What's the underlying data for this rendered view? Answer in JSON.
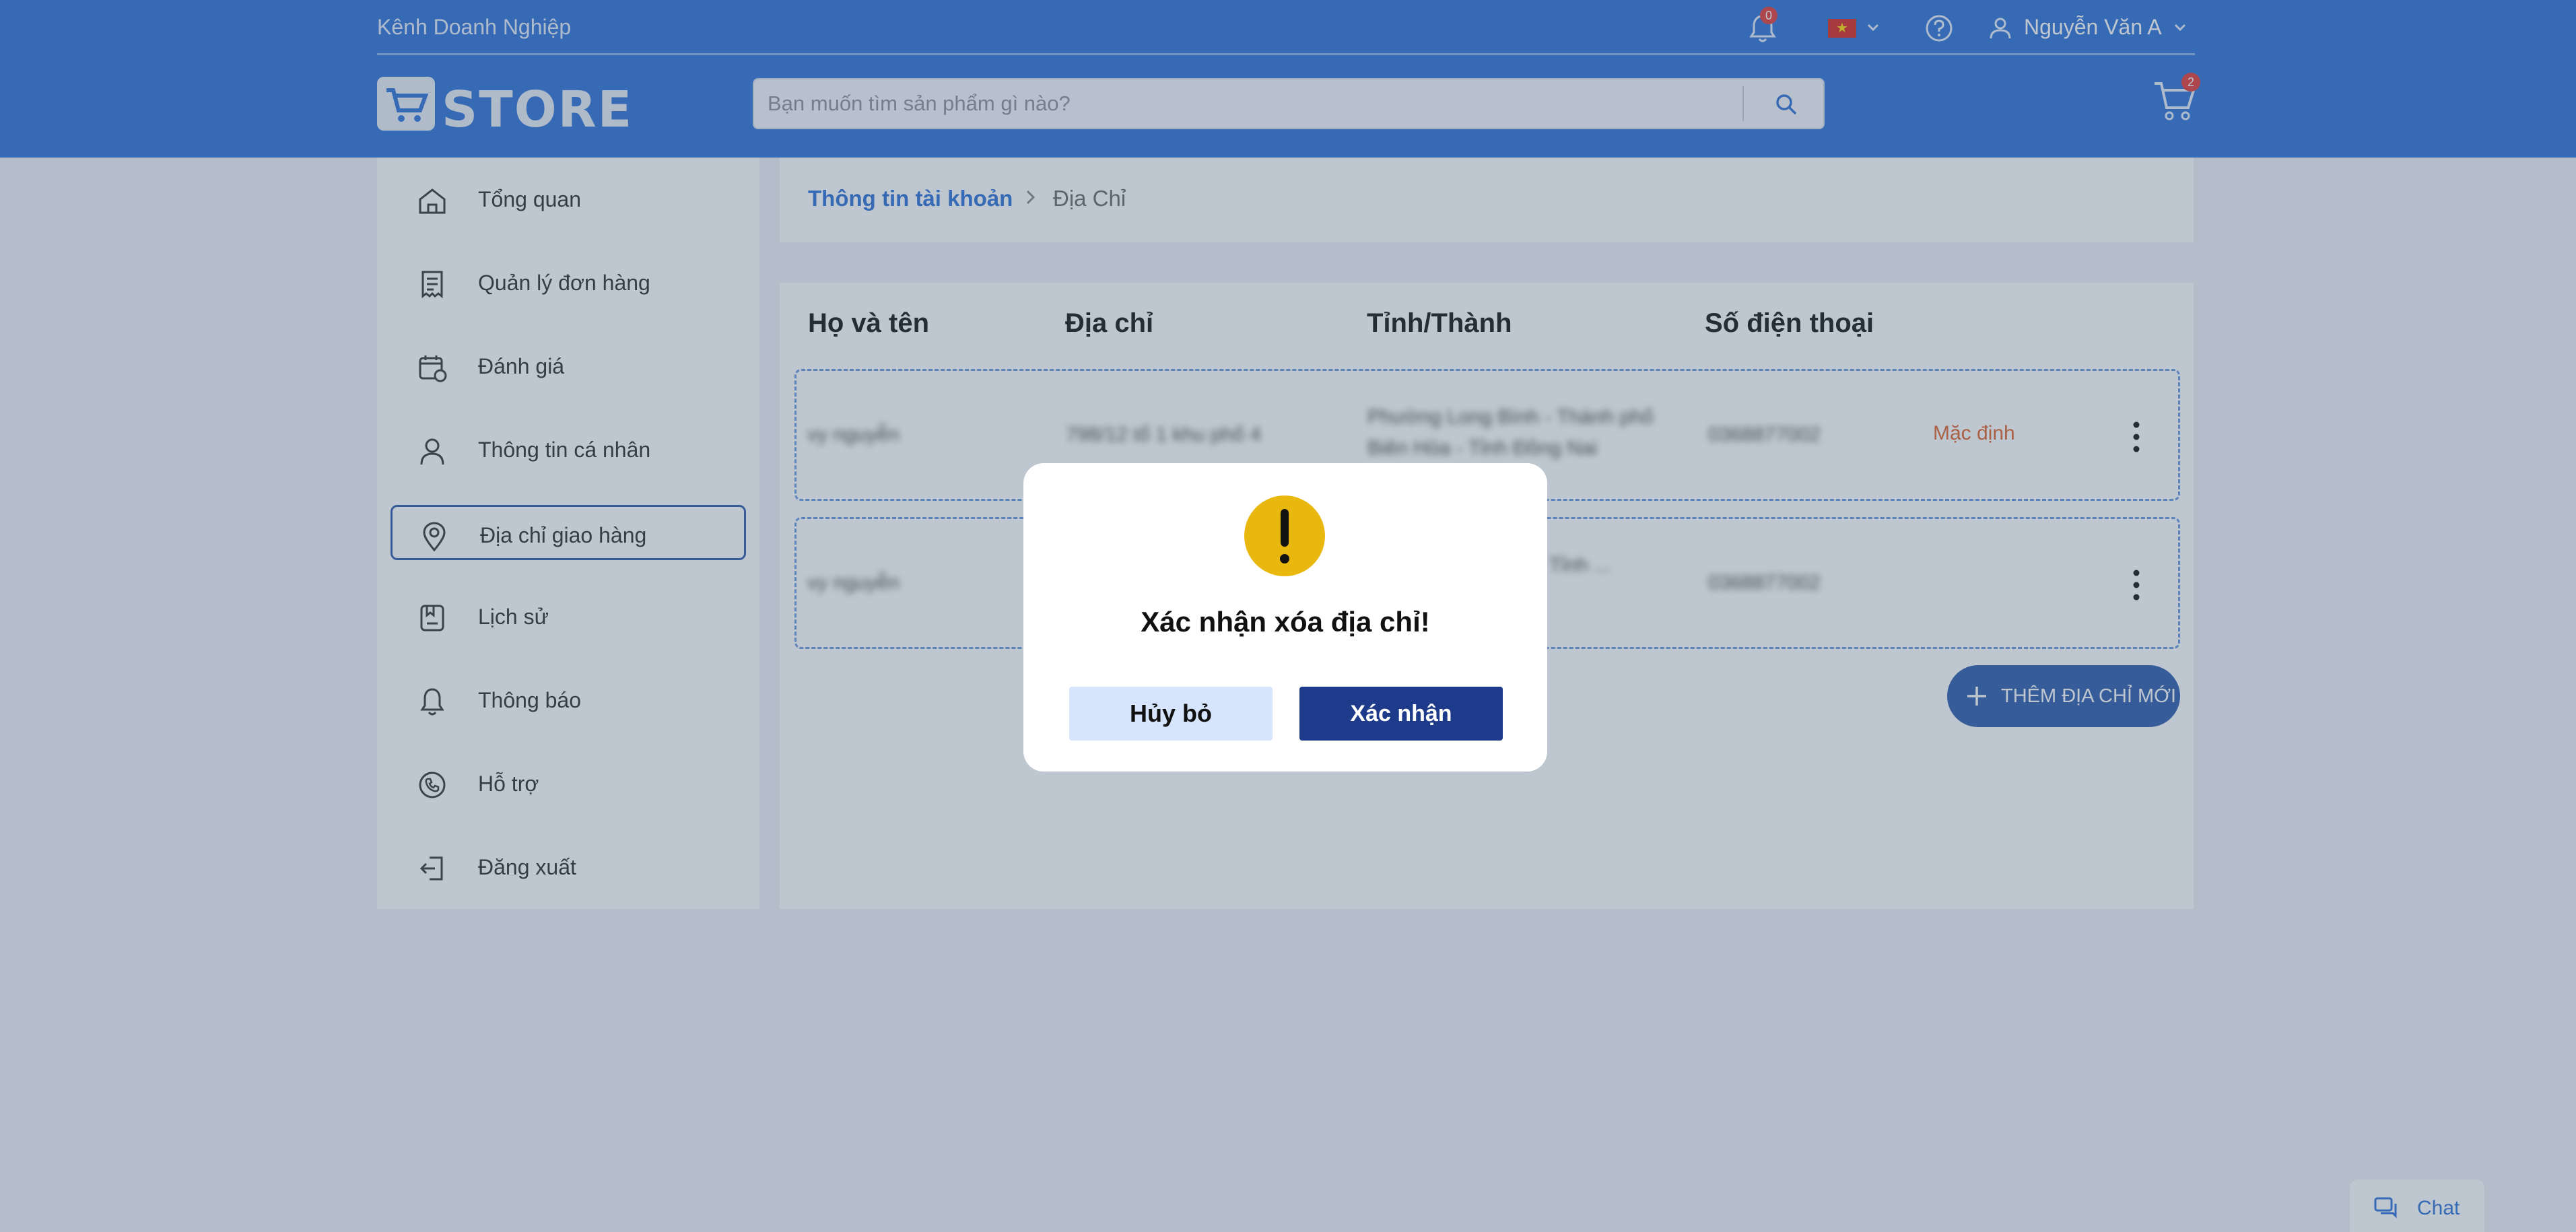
{
  "header": {
    "business_link": "Kênh Doanh Nghiệp",
    "notification_count": "0",
    "language_flag": "vietnam-flag-icon",
    "user_name": "Nguyễn Văn A",
    "logo_text": "STORE",
    "search_placeholder": "Bạn muốn tìm sản phẩm gì nào?",
    "cart_count": "2"
  },
  "sidebar": {
    "items": [
      {
        "label": "Tổng quan",
        "icon": "home-icon"
      },
      {
        "label": "Quản lý đơn hàng",
        "icon": "receipt-icon"
      },
      {
        "label": "Đánh giá",
        "icon": "calendar-review-icon"
      },
      {
        "label": "Thông tin cá nhân",
        "icon": "user-icon"
      },
      {
        "label": "Địa chỉ giao hàng",
        "icon": "location-pin-icon",
        "active": true
      },
      {
        "label": "Lịch sử",
        "icon": "history-icon"
      },
      {
        "label": "Thông báo",
        "icon": "bell-icon"
      },
      {
        "label": "Hỗ trợ",
        "icon": "phone-support-icon"
      },
      {
        "label": "Đăng xuất",
        "icon": "logout-icon"
      }
    ]
  },
  "breadcrumb": {
    "parent": "Thông tin tài khoản",
    "current": "Địa Chỉ"
  },
  "address_table": {
    "headers": [
      "Họ và tên",
      "Địa chỉ",
      "Tỉnh/Thành",
      "Số điện thoại"
    ],
    "rows": [
      {
        "name": "vy nguyễn",
        "address": "798/12 tổ 1 khu phố 4",
        "province": "Phường Long Bình - Thành phố Biên Hòa - Tỉnh Đồng Nai",
        "phone": "0368877002",
        "default_label": "Mặc định"
      },
      {
        "name": "vy nguyễn",
        "address": "",
        "province": "... Xã Vĩnh Hiệp - ... Tỉnh ...",
        "phone": "0368877002",
        "default_label": ""
      }
    ],
    "add_button": "THÊM ĐỊA CHỈ MỚI"
  },
  "chat": {
    "label": "Chat"
  },
  "dialog": {
    "title": "Xác nhận xóa địa chỉ!",
    "cancel_label": "Hủy bỏ",
    "confirm_label": "Xác nhận"
  },
  "colors": {
    "header_blue": "#2b6fd6",
    "primary_dark": "#1e3a8a",
    "warning_yellow": "#e8b80f",
    "default_orange": "#e0622a"
  }
}
